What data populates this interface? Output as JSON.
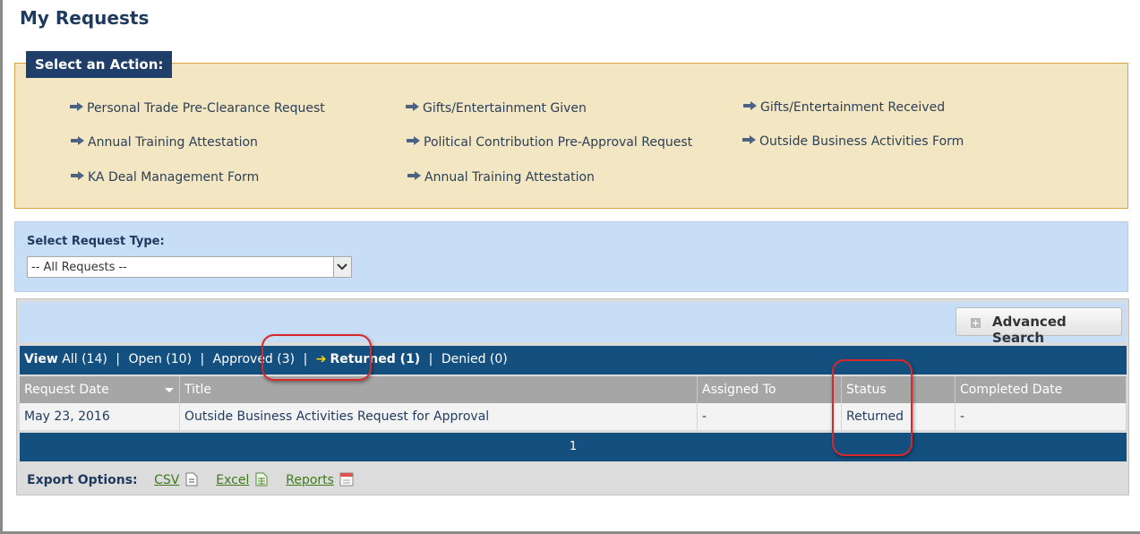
{
  "page_title": "My Requests",
  "actions": {
    "header": "Select an Action:",
    "links": [
      "Personal Trade Pre-Clearance Request",
      "Gifts/Entertainment Given",
      "Gifts/Entertainment Received",
      "Annual Training Attestation",
      "Political Contribution Pre-Approval Request",
      "Outside Business Activities Form",
      "KA Deal Management Form",
      "Annual Training Attestation"
    ]
  },
  "request_type": {
    "label": "Select Request Type:",
    "selected": "-- All Requests --"
  },
  "advanced_search": "Advanced Search",
  "filters": {
    "view_label": "View",
    "all": "All (14)",
    "open": "Open (10)",
    "approved": "Approved (3)",
    "returned": "Returned (1)",
    "denied": "Denied (0)",
    "separator": "|"
  },
  "table": {
    "columns": [
      "Request Date",
      "Title",
      "Assigned To",
      "Status",
      "Completed Date"
    ],
    "rows": [
      [
        "May 23, 2016",
        "Outside Business Activities Request for Approval",
        "-",
        "Returned",
        "-"
      ]
    ]
  },
  "pager": "1",
  "export": {
    "label": "Export Options:",
    "csv": "CSV",
    "excel": "Excel",
    "reports": "Reports"
  },
  "colors": {
    "navy": "#1f3f6a",
    "filter_bar": "#14507f",
    "action_bg": "#f3e6c2",
    "highlight": "#d8282b"
  }
}
